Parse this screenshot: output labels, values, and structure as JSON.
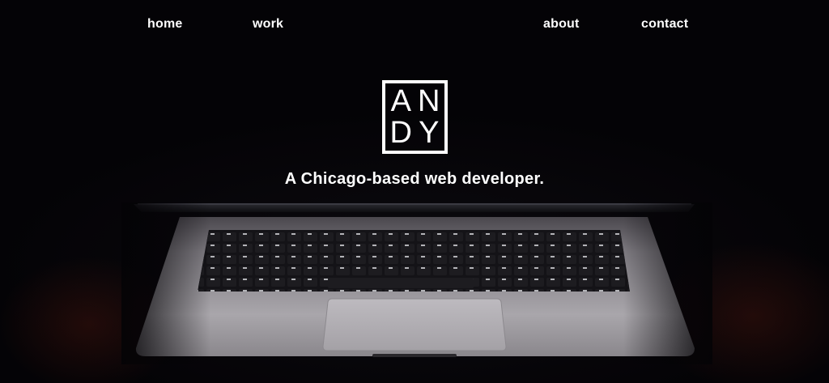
{
  "nav": {
    "home": "home",
    "work": "work",
    "about": "about",
    "contact": "contact"
  },
  "logo": {
    "letters": [
      "A",
      "N",
      "D",
      "Y"
    ]
  },
  "hero": {
    "tagline": "A Chicago-based web developer."
  },
  "colors": {
    "background": "#040306",
    "text": "#ffffff",
    "laptop_body": "#9a979c",
    "keyboard": "#1b1a1e"
  }
}
